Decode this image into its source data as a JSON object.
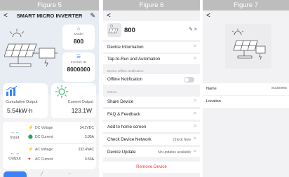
{
  "figure5": {
    "caption": "Figure 5",
    "title": "SMART MICRO INVERTER",
    "model_label": "Model",
    "model_value": "800",
    "inverter_id_label": "Inverter ID",
    "inverter_id_value": "8000000",
    "cumulative_label": "Cumulative Output",
    "cumulative_value": "5.54kW·h",
    "current_label": "Current Output",
    "current_value": "123.1W",
    "input_label": "Input",
    "output_label": "Output",
    "rows": [
      {
        "name": "DC Voltage",
        "value": "34.2VDC"
      },
      {
        "name": "DC Current",
        "value": "3.95A"
      },
      {
        "name": "AC Voltage",
        "value": "232.4VAC"
      },
      {
        "name": "AC Current",
        "value": "0.53A"
      }
    ],
    "colors": {
      "accent": "#3b82f6",
      "dc": "#21a366",
      "ac": "#e53935",
      "sun": "#3cb371"
    }
  },
  "figure6": {
    "caption": "Figure 6",
    "device_name": "800",
    "items": [
      {
        "label": "Device Information"
      },
      {
        "label": "Tap-to-Run and Automation"
      }
    ],
    "section_offline": "Device Offline Notification",
    "offline_label": "Offline Notification",
    "offline_enabled": false,
    "section_others": "Others",
    "others": [
      {
        "label": "Share Device",
        "extra": ""
      },
      {
        "label": "FAQ & Feedback",
        "extra": ""
      },
      {
        "label": "Add to home screen",
        "extra": ""
      },
      {
        "label": "Check Device Network",
        "extra": "Check Now"
      },
      {
        "label": "Device Update",
        "extra": "No updates available"
      }
    ],
    "remove_label": "Remove Device"
  },
  "figure7": {
    "caption": "Figure 7",
    "name_label": "Name",
    "name_value": "SG300MS",
    "location_label": "Location",
    "location_value": ""
  }
}
